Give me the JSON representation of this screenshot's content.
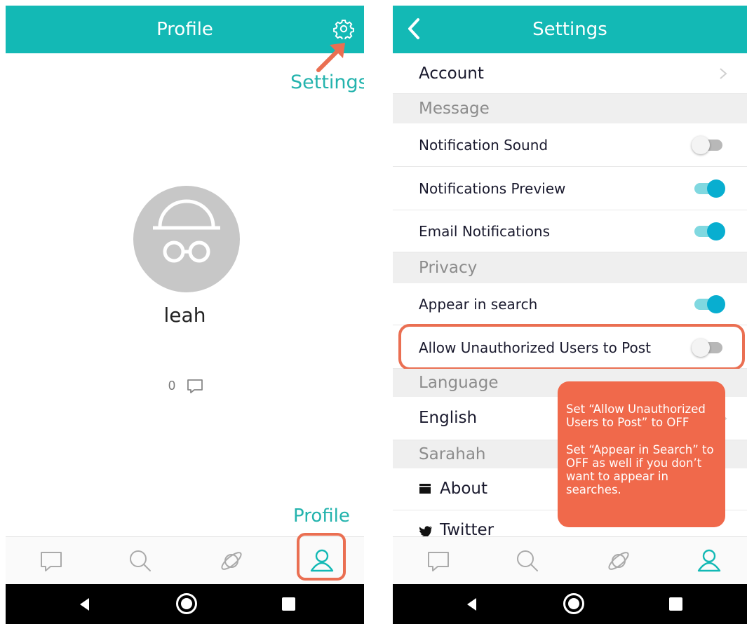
{
  "profile_screen": {
    "title": "Profile",
    "settings_callout": "Settings",
    "username": "leah",
    "message_count": "0",
    "profile_callout": "Profile"
  },
  "settings_screen": {
    "title": "Settings",
    "account_label": "Account",
    "sections": {
      "message": "Message",
      "privacy": "Privacy",
      "language": "Language",
      "sarahah": "Sarahah"
    },
    "message_rows": [
      {
        "label": "Notification Sound",
        "on": false
      },
      {
        "label": "Notifications Preview",
        "on": true
      },
      {
        "label": "Email Notifications",
        "on": true
      }
    ],
    "privacy_rows": [
      {
        "label": "Appear in search",
        "on": true
      },
      {
        "label": "Allow Unauthorized Users to Post",
        "on": false
      }
    ],
    "language_value": "English",
    "sarahah_rows": [
      {
        "label": "About",
        "icon": "calendar-icon"
      },
      {
        "label": "Twitter",
        "icon": "twitter-icon"
      }
    ],
    "tip": {
      "line1": "Set “Allow Unauthorized Users to Post” to OFF",
      "line2": "Set “Appear in Search” to OFF as well if you don’t want to appear in searches."
    }
  },
  "colors": {
    "brand": "#13b9b5",
    "toggle_on": "#08aed0",
    "annotation": "#ea6f52",
    "tip_background": "#f0694b"
  },
  "tab_icons": [
    "chat-icon",
    "search-icon",
    "planet-icon",
    "user-icon"
  ],
  "android_nav": [
    "back-icon",
    "home-icon",
    "recents-icon"
  ]
}
